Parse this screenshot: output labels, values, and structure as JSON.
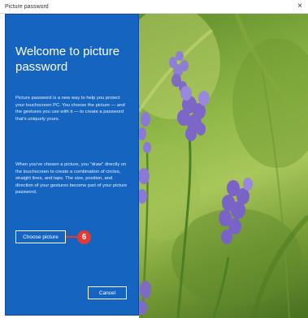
{
  "window": {
    "title": "Picture password",
    "close_glyph": "×"
  },
  "panel": {
    "heading": "Welcome to picture password",
    "paragraph1": "Picture password is a new way to help you protect your touchscreen PC. You choose the picture — and the gestures you use with it — to create a password that's uniquely yours.",
    "paragraph2": "When you've chosen a picture, you \"draw\" directly on the touchscreen to create a combination of circles, straight lines, and taps. The size, position, and direction of your gestures become part of your picture password.",
    "choose_button": "Choose picture",
    "cancel_button": "Cancel",
    "step_number": "6",
    "accent_color": "#1565c0",
    "callout_color": "#e53935"
  },
  "photo": {
    "subject": "lavender-flowers-image"
  }
}
